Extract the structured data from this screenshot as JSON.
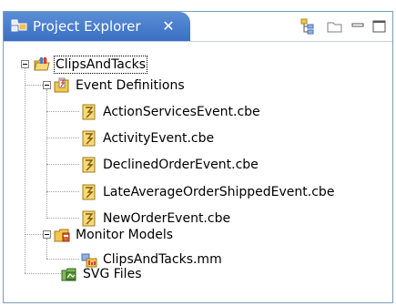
{
  "view": {
    "tab_title": "Project Explorer",
    "close_glyph": "✕",
    "icons": {
      "view_icon": "project-explorer-icon",
      "toolbar": [
        "link-with-editor-icon",
        "collapse-all-icon",
        "minimize-icon",
        "maximize-icon"
      ]
    }
  },
  "tree": {
    "project": {
      "label": "ClipsAndTacks",
      "icon": "project-folder-icon",
      "expanded": true
    },
    "event_definitions": {
      "label": "Event Definitions",
      "icon": "event-folder-icon",
      "expanded": true,
      "files": [
        {
          "label": "ActionServicesEvent.cbe"
        },
        {
          "label": "ActivityEvent.cbe"
        },
        {
          "label": "DeclinedOrderEvent.cbe"
        },
        {
          "label": "LateAverageOrderShippedEvent.cbe"
        },
        {
          "label": "NewOrderEvent.cbe"
        }
      ]
    },
    "monitor_models": {
      "label": "Monitor Models",
      "icon": "monitor-folder-icon",
      "expanded": true,
      "files": [
        {
          "label": "ClipsAndTacks.mm"
        }
      ]
    },
    "svg_files": {
      "label": "SVG Files",
      "icon": "svg-folder-icon"
    }
  },
  "colors": {
    "tab_active": "#4a7fcf",
    "border": "#7f9db9",
    "folder_yellow": "#f2c84b"
  }
}
